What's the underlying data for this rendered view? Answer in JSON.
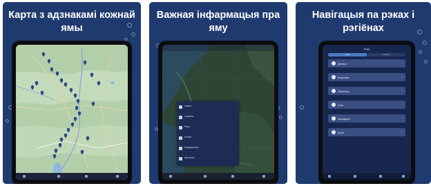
{
  "panels": [
    {
      "caption": "Карта з адзнакамі кожнай ямы"
    },
    {
      "caption": "Важная інфармацыя пра яму"
    },
    {
      "caption": "Навігацыя па рэках і рэгіёнах"
    }
  ],
  "icons": {
    "pin": "map-pin-icon",
    "row": "info-icon",
    "river": "water-drop-icon",
    "chevron": "chevron-right-icon"
  },
  "colors": {
    "card_bg": "#1f3a6e",
    "map_land": "#a8c9a4",
    "satellite": "#2a4233",
    "pin": "#2a4d7a",
    "river_row": "#3a4e82"
  },
  "detail_popup": {
    "rows": [
      {
        "label": "Назва"
      },
      {
        "label": "Глыбіня"
      },
      {
        "label": "Рака"
      },
      {
        "label": "Рэгіён"
      },
      {
        "label": "Каардынаты"
      },
      {
        "label": "Апісанне"
      }
    ]
  },
  "river_screen": {
    "title": "Рэкі",
    "segments": [
      "Рэкі",
      "Рэгіёны"
    ],
    "items": [
      {
        "label": "Дняпро"
      },
      {
        "label": "Бярэзіна"
      },
      {
        "label": "Прыпяць"
      },
      {
        "label": "Сож"
      },
      {
        "label": "Заходняя"
      },
      {
        "label": "Вілія"
      }
    ]
  }
}
